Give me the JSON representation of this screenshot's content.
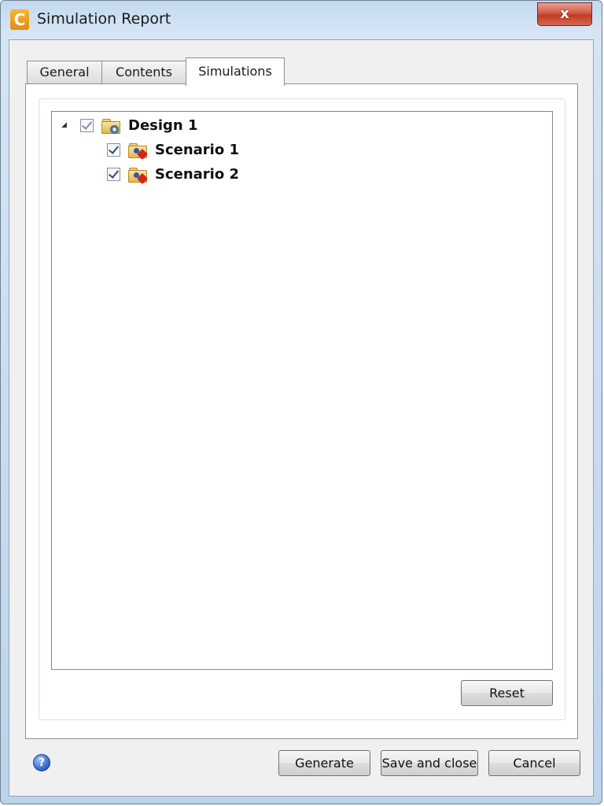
{
  "window": {
    "title": "Simulation Report",
    "close_glyph": "x",
    "app_icon_glyph": "C"
  },
  "tabs": [
    {
      "label": "General",
      "active": false
    },
    {
      "label": "Contents",
      "active": false
    },
    {
      "label": "Simulations",
      "active": true
    }
  ],
  "tree": {
    "root": {
      "label": "Design 1",
      "checked": true,
      "expanded": true,
      "icon": "design-folder-icon",
      "children": [
        {
          "label": "Scenario 1",
          "checked": true,
          "icon": "scenario-folder-icon"
        },
        {
          "label": "Scenario 2",
          "checked": true,
          "icon": "scenario-folder-icon"
        }
      ]
    },
    "expander_glyph": "◢"
  },
  "buttons": {
    "reset": "Reset",
    "generate": "Generate",
    "save_and_close": "Save and close",
    "cancel": "Cancel"
  },
  "help": {
    "glyph": "?"
  },
  "colors": {
    "title_gradient_top": "#c3d9ef",
    "close_red": "#c23c22",
    "app_icon_orange": "#e38b10",
    "help_blue": "#2a62c8",
    "check_blue": "#2a4a8a"
  }
}
